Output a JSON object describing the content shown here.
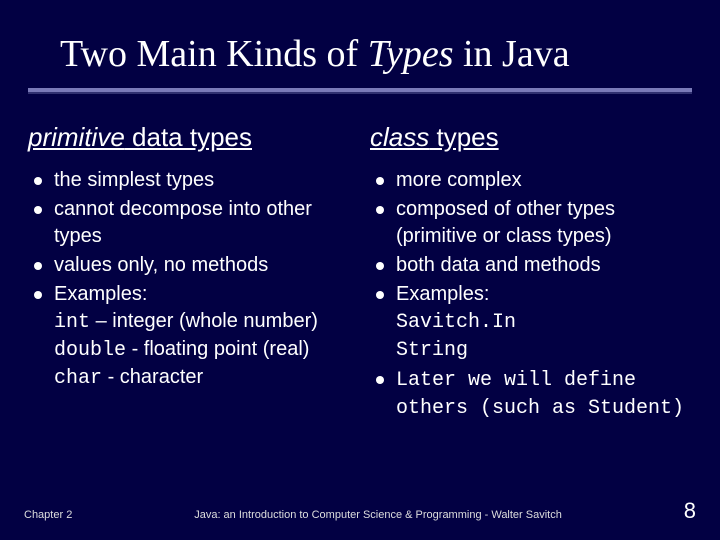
{
  "title": {
    "pre": "Two Main Kinds of ",
    "emph": "Types",
    "post": " in Java"
  },
  "left": {
    "heading_emph": "primitive",
    "heading_rest": " data types",
    "items": [
      {
        "text": "the simplest types"
      },
      {
        "text": "cannot decompose into other types"
      },
      {
        "text": "values only, no methods"
      },
      {
        "text": "Examples:",
        "subs": [
          {
            "mono": "int",
            "plain": " – integer (whole number)"
          },
          {
            "mono": "double",
            "plain": " - floating point (real)"
          },
          {
            "mono": "char",
            "plain": " - character"
          }
        ]
      }
    ]
  },
  "right": {
    "heading_emph": "class",
    "heading_rest": " types",
    "items": [
      {
        "text": "more complex"
      },
      {
        "text": "composed of other types (primitive or class types)"
      },
      {
        "text": "both data and methods"
      },
      {
        "text": "Examples:",
        "subs": [
          {
            "mono": "Savitch.In",
            "plain": ""
          },
          {
            "mono": "String",
            "plain": ""
          }
        ]
      },
      {
        "mono_text": "Later we will define others (such as Student)"
      }
    ]
  },
  "footer": {
    "left": "Chapter 2",
    "center": "Java: an Introduction to Computer Science & Programming - Walter Savitch",
    "right": "8"
  }
}
